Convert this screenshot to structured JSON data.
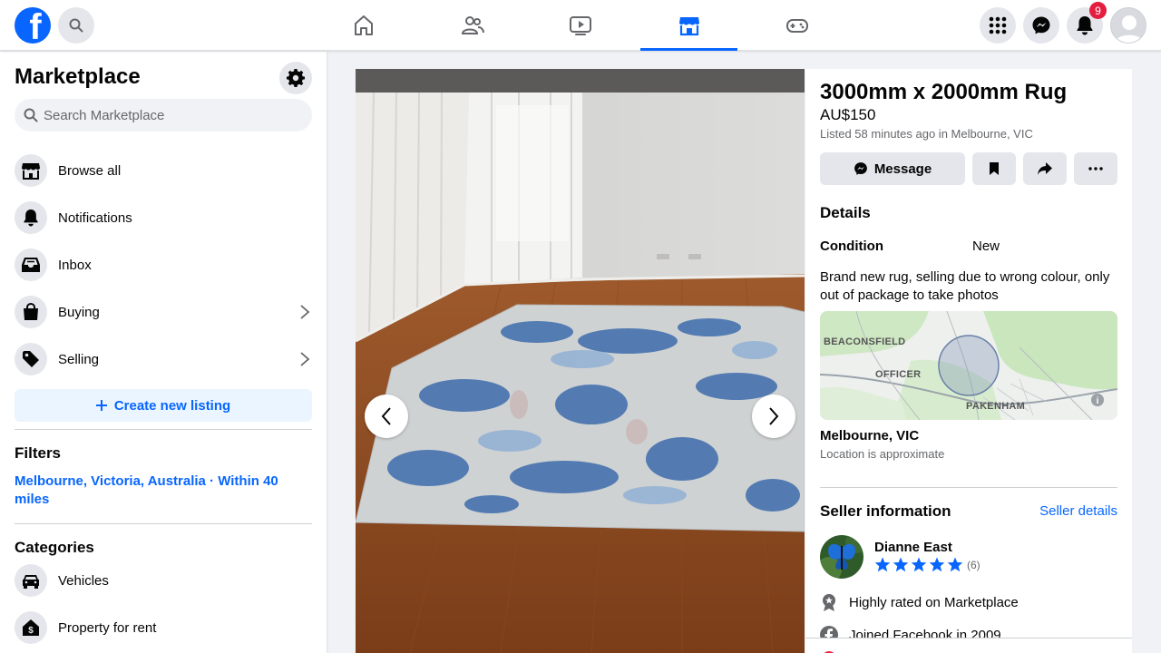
{
  "topnav": {
    "logo_letter": "f",
    "tabs": [
      "home-icon",
      "friends-icon",
      "watch-icon",
      "marketplace-icon",
      "gaming-icon"
    ],
    "active_tab": "marketplace-icon",
    "notification_count": "9"
  },
  "sidebar": {
    "title": "Marketplace",
    "search_placeholder": "Search Marketplace",
    "items": [
      {
        "label": "Browse all",
        "icon": "storefront-icon"
      },
      {
        "label": "Notifications",
        "icon": "bell-icon"
      },
      {
        "label": "Inbox",
        "icon": "inbox-icon"
      },
      {
        "label": "Buying",
        "icon": "shopping-bag-icon"
      },
      {
        "label": "Selling",
        "icon": "price-tag-icon"
      }
    ],
    "create_label": "Create new listing",
    "filters_heading": "Filters",
    "filter_location": "Melbourne, Victoria, Australia · Within 40 miles",
    "categories_heading": "Categories",
    "categories": [
      {
        "label": "Vehicles",
        "icon": "car-icon"
      },
      {
        "label": "Property for rent",
        "icon": "house-dollar-icon"
      }
    ]
  },
  "listing": {
    "title": "3000mm x 2000mm Rug",
    "price": "AU$150",
    "listed": "Listed 58 minutes ago in Melbourne, VIC",
    "message_label": "Message",
    "details_heading": "Details",
    "condition_label": "Condition",
    "condition_value": "New",
    "description": "Brand new rug, selling due to wrong colour, only out of package to take photos",
    "map_labels": [
      "BEACONSFIELD",
      "OFFICER",
      "PAKENHAM"
    ],
    "location": "Melbourne, VIC",
    "location_note": "Location is approximate"
  },
  "seller": {
    "heading": "Seller information",
    "details_link": "Seller details",
    "name": "Dianne East",
    "rating_stars": 5,
    "rating_count": "(6)",
    "badges": [
      {
        "text": "Highly rated on Marketplace",
        "icon": "award-icon"
      },
      {
        "text": "Joined Facebook in 2009",
        "icon": "facebook-icon"
      }
    ]
  },
  "colors": {
    "brand": "#0866ff",
    "badge": "#e41e3f"
  }
}
